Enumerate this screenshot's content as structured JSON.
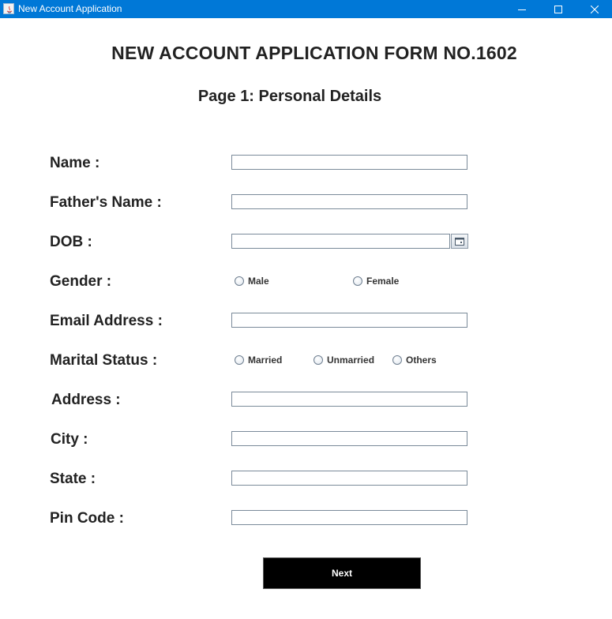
{
  "window": {
    "title": "New Account Application",
    "controls": [
      "minimize-icon",
      "maximize-icon",
      "close-icon"
    ]
  },
  "header": {
    "title": "NEW ACCOUNT APPLICATION FORM NO.1602",
    "subtitle": "Page 1: Personal Details"
  },
  "form": {
    "name_label": "Name :",
    "name_value": "",
    "father_label": "Father's Name :",
    "father_value": "",
    "dob_label": "DOB :",
    "dob_value": "",
    "dob_picker_icon": "calendar-icon",
    "gender_label": "Gender :",
    "gender_options": [
      "Male",
      "Female"
    ],
    "email_label": "Email Address :",
    "email_value": "",
    "marital_label": "Marital Status :",
    "marital_options": [
      "Married",
      "Unmarried",
      "Others"
    ],
    "address_label": "Address :",
    "address_value": "",
    "city_label": "City :",
    "city_value": "",
    "state_label": "State :",
    "state_value": "",
    "pin_label": "Pin Code :",
    "pin_value": ""
  },
  "actions": {
    "next_label": "Next"
  },
  "colors": {
    "titlebar": "#0078d7",
    "next_button_bg": "#000000",
    "next_button_text": "#ffffff"
  }
}
